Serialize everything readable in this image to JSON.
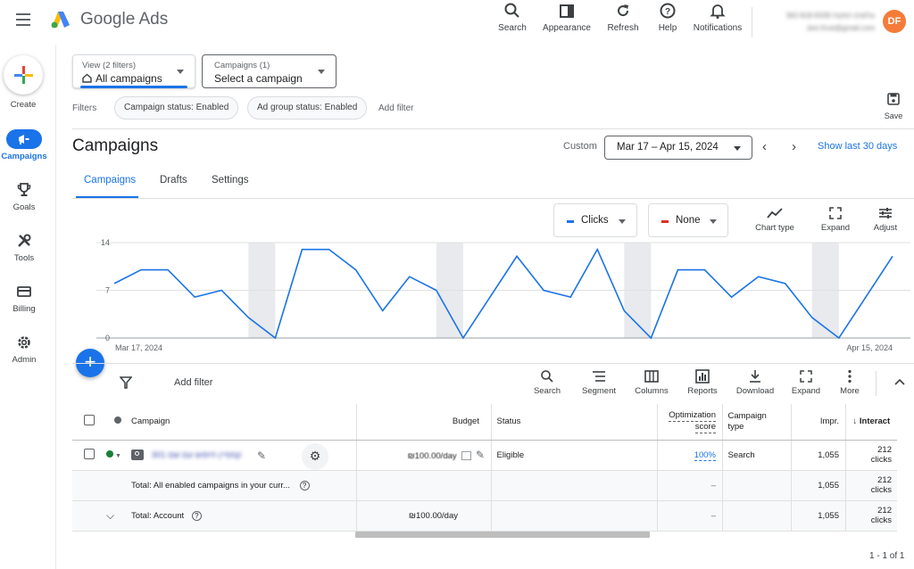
{
  "app": {
    "title": "Google Ads"
  },
  "header": {
    "actions": [
      {
        "label": "Search",
        "icon": "search-icon"
      },
      {
        "label": "Appearance",
        "icon": "appearance-icon"
      },
      {
        "label": "Refresh",
        "icon": "refresh-icon"
      },
      {
        "label": "Help",
        "icon": "help-icon"
      },
      {
        "label": "Notifications",
        "icon": "bell-icon"
      }
    ],
    "account_line1": "362-818-9339 גולשים הפקות",
    "account_line2": "dori.frost@gmail.com",
    "avatar_initials": "DF"
  },
  "leftnav": {
    "create_label": "Create",
    "items": [
      {
        "label": "Campaigns",
        "icon": "megaphone-icon",
        "active": true
      },
      {
        "label": "Goals",
        "icon": "trophy-icon"
      },
      {
        "label": "Tools",
        "icon": "tools-icon"
      },
      {
        "label": "Billing",
        "icon": "card-icon"
      },
      {
        "label": "Admin",
        "icon": "gear-icon"
      }
    ]
  },
  "view": {
    "small": "View (2 filters)",
    "value": "All campaigns"
  },
  "campaign_picker": {
    "small": "Campaigns (1)",
    "value": "Select a campaign"
  },
  "filters": {
    "label": "Filters",
    "chips": [
      "Campaign status: Enabled",
      "Ad group status: Enabled"
    ],
    "add": "Add filter"
  },
  "save_label": "Save",
  "page": {
    "title": "Campaigns",
    "custom_label": "Custom",
    "date_range": "Mar 17 – Apr 15, 2024",
    "show_last": "Show last 30 days"
  },
  "tabs": [
    "Campaigns",
    "Drafts",
    "Settings"
  ],
  "chart_controls": {
    "metric1": "Clicks",
    "metric2": "None",
    "tools": [
      "Chart type",
      "Expand",
      "Adjust"
    ]
  },
  "colors": {
    "accent": "#1a73e8",
    "metric2": "#d93025",
    "enabled": "#188038",
    "avatar": "#f57c38"
  },
  "chart_data": {
    "type": "line",
    "series": [
      {
        "name": "Clicks",
        "values": [
          8,
          10,
          10,
          6,
          7,
          3,
          0,
          13,
          13,
          10,
          4,
          9,
          7,
          0,
          6,
          12,
          7,
          6,
          13,
          4,
          0,
          10,
          10,
          6,
          9,
          8,
          3,
          0,
          6,
          12
        ]
      }
    ],
    "ylim": [
      0,
      14
    ],
    "yticks": [
      "0",
      "7",
      "14"
    ],
    "x_start_label": "Mar 17, 2024",
    "x_end_label": "Apr 15, 2024",
    "weekend_bands_start_index": [
      6,
      13,
      20,
      27
    ],
    "grid": true
  },
  "table_toolbar": {
    "add_filter": "Add filter",
    "tools": [
      "Search",
      "Segment",
      "Columns",
      "Reports",
      "Download",
      "Expand",
      "More"
    ]
  },
  "table": {
    "headers": {
      "campaign": "Campaign",
      "budget": "Budget",
      "status": "Status",
      "opt_line1": "Optimization",
      "opt_line2": "score",
      "type_line1": "Campaign",
      "type_line2": "type",
      "impr": "Impr.",
      "interact": "Interact"
    },
    "row": {
      "name": "301 קמפיין חיפוש עם שם",
      "budget": "₪100.00/day",
      "status": "Eligible",
      "opt_score": "100%",
      "type": "Search",
      "impr": "1,055",
      "interact1": "212",
      "interact2": "clicks"
    },
    "total1": {
      "label": "Total: All enabled campaigns in your curr...",
      "opt": "–",
      "impr": "1,055",
      "interact1": "212",
      "interact2": "clicks"
    },
    "total2": {
      "label": "Total: Account",
      "budget": "₪100.00/day",
      "opt": "–",
      "impr": "1,055",
      "interact1": "212",
      "interact2": "clicks"
    }
  },
  "pager": "1 - 1 of 1"
}
